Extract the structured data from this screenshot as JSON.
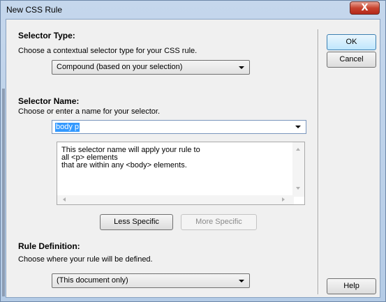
{
  "window": {
    "title": "New CSS Rule",
    "close_label": "X"
  },
  "selector_type": {
    "heading": "Selector Type:",
    "description": "Choose a contextual selector type for your CSS rule.",
    "value": "Compound (based on your selection)"
  },
  "selector_name": {
    "heading": "Selector Name:",
    "description": "Choose or enter a name for your selector.",
    "value": "body p",
    "explanation_lines": [
      "This selector name will apply your rule to",
      "all <p> elements",
      "that are within any <body> elements."
    ],
    "less_specific_label": "Less Specific",
    "more_specific_label": "More Specific"
  },
  "rule_definition": {
    "heading": "Rule Definition:",
    "description": "Choose where your rule will be defined.",
    "value": "(This document only)"
  },
  "buttons": {
    "ok": "OK",
    "cancel": "Cancel",
    "help": "Help"
  },
  "colors": {
    "selection_highlight": "#3399ff",
    "default_button_border": "#3c7fb1",
    "close_button": "#c7432f"
  }
}
